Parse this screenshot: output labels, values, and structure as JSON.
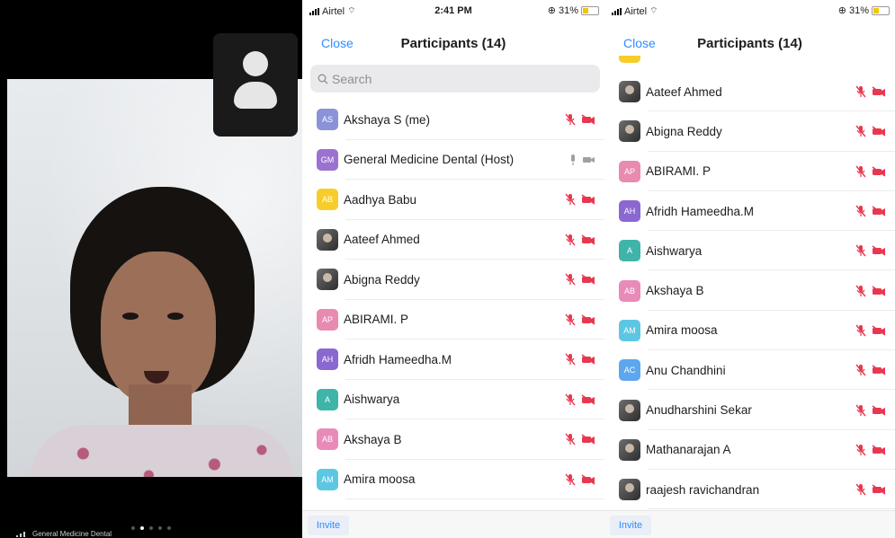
{
  "video": {
    "feed_name": "General Medicine Dental"
  },
  "colors": {
    "accent": "#2d8cff",
    "muted_red": "#e8384f",
    "avatar_as": "#8a93d8",
    "avatar_gm": "#9b72cf",
    "avatar_ab_yellow": "#f8cd2b",
    "avatar_ap": "#e98ab0",
    "avatar_ah": "#8b67d1",
    "avatar_a": "#3fb4a8",
    "avatar_akb": "#e88bb8",
    "avatar_am": "#5cc7e3",
    "avatar_ac": "#5ca7ef"
  },
  "phone1": {
    "status": {
      "carrier": "Airtel",
      "time": "2:41 PM",
      "battery": "31%"
    },
    "close_label": "Close",
    "title": "Participants (14)",
    "search_placeholder": "Search",
    "invite_label": "Invite",
    "participants": [
      {
        "initials": "AS",
        "name": "Akshaya S (me)",
        "avatar_color": "#8a93d8",
        "state": "muted"
      },
      {
        "initials": "GM",
        "name": "General Medicine Dental (Host)",
        "avatar_color": "#9b72cf",
        "state": "active"
      },
      {
        "initials": "AB",
        "name": "Aadhya Babu",
        "avatar_color": "#f8cd2b",
        "state": "muted"
      },
      {
        "initials": "",
        "name": "Aateef Ahmed",
        "avatar_color": "photo",
        "state": "muted"
      },
      {
        "initials": "",
        "name": "Abigna Reddy",
        "avatar_color": "photo",
        "state": "muted"
      },
      {
        "initials": "AP",
        "name": "ABIRAMI. P",
        "avatar_color": "#e98ab0",
        "state": "muted"
      },
      {
        "initials": "AH",
        "name": "Afridh Hameedha.M",
        "avatar_color": "#8b67d1",
        "state": "muted"
      },
      {
        "initials": "A",
        "name": "Aishwarya",
        "avatar_color": "#3fb4a8",
        "state": "muted"
      },
      {
        "initials": "AB",
        "name": "Akshaya B",
        "avatar_color": "#e88bb8",
        "state": "muted"
      },
      {
        "initials": "AM",
        "name": "Amira moosa",
        "avatar_color": "#5cc7e3",
        "state": "muted"
      }
    ]
  },
  "phone2": {
    "status": {
      "carrier": "Airtel",
      "battery": "31%"
    },
    "close_label": "Close",
    "title": "Participants (14)",
    "invite_label": "Invite",
    "participants": [
      {
        "initials": "",
        "name": "Aateef Ahmed",
        "avatar_color": "photo",
        "state": "muted"
      },
      {
        "initials": "",
        "name": "Abigna Reddy",
        "avatar_color": "photo",
        "state": "muted"
      },
      {
        "initials": "AP",
        "name": "ABIRAMI. P",
        "avatar_color": "#e98ab0",
        "state": "muted"
      },
      {
        "initials": "AH",
        "name": "Afridh Hameedha.M",
        "avatar_color": "#8b67d1",
        "state": "muted"
      },
      {
        "initials": "A",
        "name": "Aishwarya",
        "avatar_color": "#3fb4a8",
        "state": "muted"
      },
      {
        "initials": "AB",
        "name": "Akshaya B",
        "avatar_color": "#e88bb8",
        "state": "muted"
      },
      {
        "initials": "AM",
        "name": "Amira moosa",
        "avatar_color": "#5cc7e3",
        "state": "muted"
      },
      {
        "initials": "AC",
        "name": "Anu Chandhini",
        "avatar_color": "#5ca7ef",
        "state": "muted"
      },
      {
        "initials": "",
        "name": "Anudharshini Sekar",
        "avatar_color": "photo",
        "state": "muted"
      },
      {
        "initials": "",
        "name": "Mathanarajan A",
        "avatar_color": "photo",
        "state": "muted"
      },
      {
        "initials": "",
        "name": "raajesh ravichandran",
        "avatar_color": "photo",
        "state": "muted"
      }
    ]
  }
}
